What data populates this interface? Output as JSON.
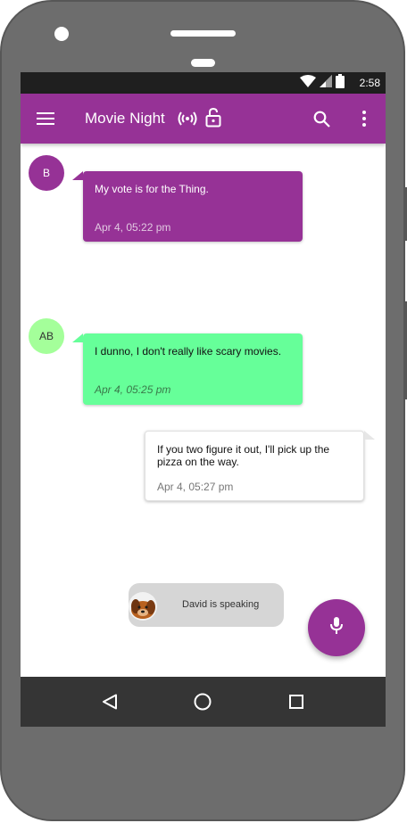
{
  "status_bar": {
    "time": "2:58",
    "icons": [
      "wifi-icon",
      "cell-signal-icon",
      "battery-icon"
    ]
  },
  "app_bar": {
    "title": "Movie Night",
    "icons": [
      "menu-icon",
      "broadcast-icon",
      "lock-open-icon",
      "search-icon",
      "more-vert-icon"
    ],
    "color": "#963296"
  },
  "messages": [
    {
      "avatar_initials": "B",
      "text": "My vote is for the Thing.",
      "time": "Apr 4, 05:22 pm",
      "side": "left",
      "bubble_color": "#963296",
      "text_color": "#ffffff"
    },
    {
      "avatar_initials": "AB",
      "text": "I dunno, I don't really like scary movies.",
      "time": "Apr 4, 05:25 pm",
      "side": "left",
      "bubble_color": "#66ff99",
      "text_color": "#000000"
    },
    {
      "avatar_initials": "",
      "text": "If you two figure it out, I'll pick up the pizza on the way.",
      "time": "Apr 4, 05:27 pm",
      "side": "right",
      "bubble_color": "#ffffff",
      "text_color": "#000000"
    }
  ],
  "speaking_indicator": {
    "text": "David is speaking",
    "avatar": "dog-avatar-image"
  },
  "fab": {
    "icon": "microphone-icon",
    "color": "#963296"
  },
  "nav_bar": {
    "icons": [
      "back-triangle-icon",
      "home-circle-icon",
      "recents-square-icon"
    ]
  }
}
